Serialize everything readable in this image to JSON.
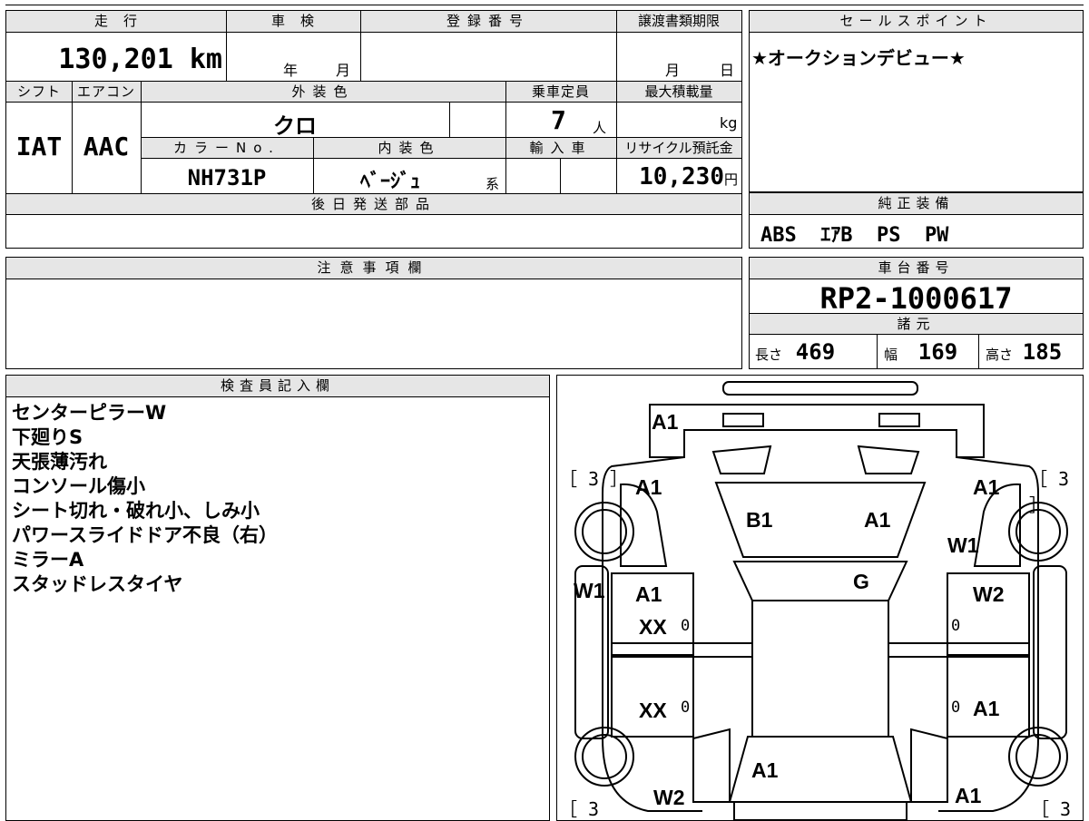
{
  "mileage": {
    "header": "走　行",
    "value": "130,201",
    "unit": "km"
  },
  "inspection": {
    "header": "車　検",
    "year_unit": "年",
    "month_unit": "月"
  },
  "registration": {
    "header": "登録番号",
    "value": ""
  },
  "transfer_deadline": {
    "header": "譲渡書類期限",
    "month_unit": "月",
    "day_unit": "日"
  },
  "sales_point": {
    "header": "セールスポイント",
    "text": "★オークションデビュー★"
  },
  "shift": {
    "header": "シフト",
    "value": "IAT"
  },
  "aircon": {
    "header": "エアコン",
    "value": "AAC"
  },
  "exterior_color": {
    "header": "外装色",
    "value": "クロ"
  },
  "capacity": {
    "header": "乗車定員",
    "value": "7",
    "unit": "人"
  },
  "max_load": {
    "header": "最大積載量",
    "value": "",
    "unit": "kg"
  },
  "color_no": {
    "header": "カラーNo.",
    "value": "NH731P"
  },
  "interior_color": {
    "header": "内装色",
    "value": "ﾍﾞｰｼﾞｭ",
    "suffix": "系"
  },
  "import": {
    "header": "輸入車"
  },
  "recycle_fee": {
    "header": "リサイクル預託金",
    "value": "10,230",
    "unit": "円"
  },
  "later_parts": {
    "header": "後日発送部品",
    "value": ""
  },
  "genuine_equipment": {
    "header": "純正装備",
    "value": "ABS  ｴｱB  PS  PW"
  },
  "caution": {
    "header": "注意事項欄",
    "value": ""
  },
  "chassis": {
    "header": "車台番号",
    "value": "RP2-1000617"
  },
  "specs": {
    "header": "諸元",
    "length_label": "長さ",
    "length": "469",
    "width_label": "幅",
    "width": "169",
    "height_label": "高さ",
    "height": "185"
  },
  "inspector": {
    "header": "検査員記入欄",
    "notes": [
      "センターピラーW",
      "下廻りS",
      "天張薄汚れ",
      "コンソール傷小",
      "シート切れ・破れ小、しみ小",
      "パワースライドドア不良（右）",
      "ミラーA",
      "スタッドレスタイヤ"
    ]
  },
  "diagram": {
    "tire_left_top": "［ 3 ］",
    "tire_right_top": "［ 3 ］",
    "tire_left_bottom": "［ 3",
    "tire_right_bottom": "［ 3",
    "labels": {
      "front_bumper": "A1",
      "front_left_fender": "A1",
      "front_right_fender": "A1",
      "hood_left": "B1",
      "hood_right": "A1",
      "right_fender_w": "W1",
      "left_pillar_w": "W1",
      "windshield": "G",
      "front_left_door": "A1",
      "front_right_door": "W2",
      "front_left_door_xx": "XX",
      "rear_left_door_xx": "XX",
      "rear_right_door": "A1",
      "rear_gate": "A1",
      "rear_left": "W2",
      "rear_right": "A1",
      "small_0_a": "0",
      "small_0_b": "0",
      "small_0_c": "0",
      "small_0_d": "0"
    }
  }
}
